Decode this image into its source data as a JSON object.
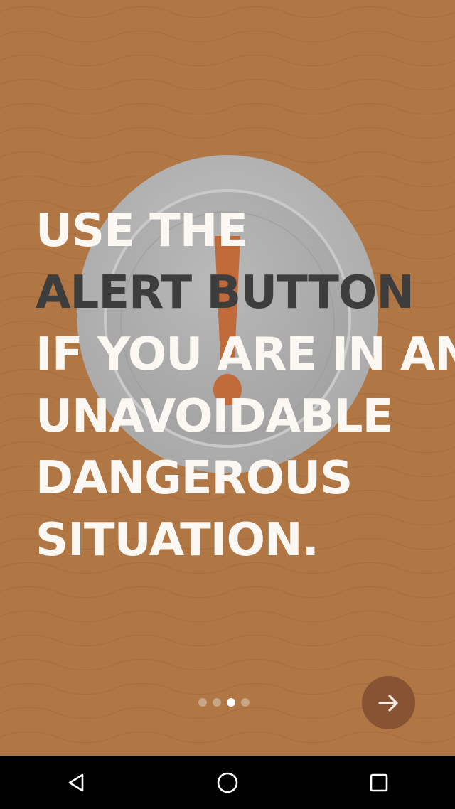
{
  "onboarding": {
    "lines": [
      "USE THE",
      "ALERT BUTTON",
      "IF YOU ARE IN AN",
      "UNAVOIDABLE",
      "DANGEROUS",
      "SITUATION."
    ],
    "page_indicator": {
      "total": 4,
      "current": 3
    },
    "colors": {
      "background": "#b07644",
      "text_light": "#fbf7f2",
      "text_dark": "#3d3d3d",
      "alert_mark": "#c06a3a",
      "next_button": "#875333"
    }
  },
  "icons": {
    "graphic": "alert-button-icon",
    "next": "arrow-right-icon",
    "back": "back-icon",
    "home": "home-icon",
    "recents": "recents-icon"
  }
}
